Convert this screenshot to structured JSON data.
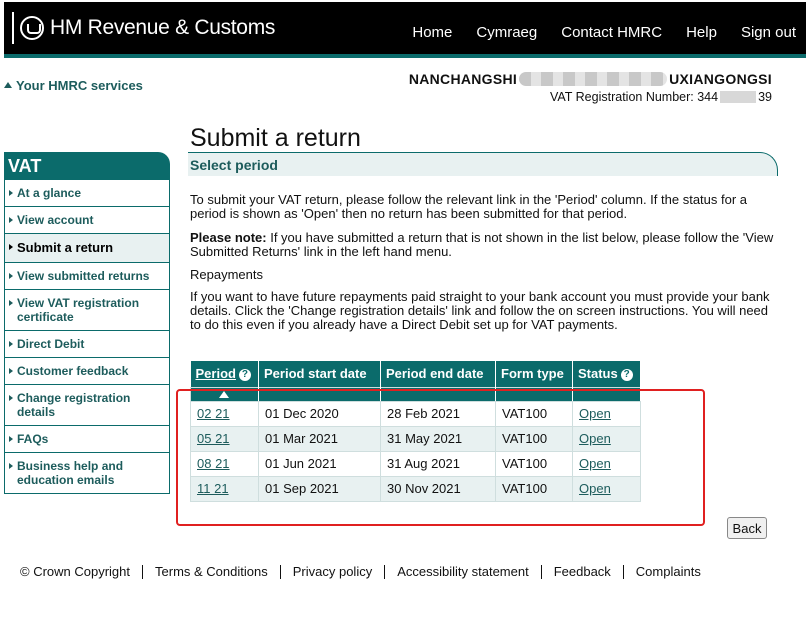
{
  "header": {
    "brand": "HM Revenue & Customs",
    "nav": [
      "Home",
      "Cymraeg",
      "Contact HMRC",
      "Help",
      "Sign out"
    ]
  },
  "services_link": "Your HMRC services",
  "company": {
    "name_start": "NANCHANGSHI",
    "name_end": "UXIANGONGSI",
    "vat_label": "VAT Registration Number: 344",
    "vat_end": "39"
  },
  "sidebar": {
    "title": "VAT",
    "items": [
      {
        "label": "At a glance"
      },
      {
        "label": "View account"
      },
      {
        "label": "Submit a return"
      },
      {
        "label": "View submitted returns"
      },
      {
        "label": "View VAT registration certificate"
      },
      {
        "label": "Direct Debit"
      },
      {
        "label": "Customer feedback"
      },
      {
        "label": "Change registration details"
      },
      {
        "label": "FAQs"
      },
      {
        "label": "Business help and education emails"
      }
    ]
  },
  "main": {
    "title": "Submit a return",
    "subtitle": "Select period",
    "intro": "To submit your VAT return, please follow the relevant link in the 'Period' column. If the status for a period is shown as 'Open' then no return has been submitted for that period.",
    "note_label": "Please note:",
    "note_text": " If you have submitted a return that is not shown in the list below, please follow the 'View Submitted Returns' link in the left hand menu.",
    "repayments_heading": "Repayments",
    "repayments_text": "If you want to have future repayments paid straight to your bank account you must provide your bank details. Click the 'Change registration details' link and follow the on screen instructions. You will need to do this even if you already have a Direct Debit set up for VAT payments."
  },
  "table": {
    "headers": [
      "Period",
      "Period start date",
      "Period end date",
      "Form type",
      "Status"
    ],
    "rows": [
      {
        "period": "02 21",
        "start": "01 Dec 2020",
        "end": "28 Feb 2021",
        "form": "VAT100",
        "status": "Open"
      },
      {
        "period": "05 21",
        "start": "01 Mar 2021",
        "end": "31 May 2021",
        "form": "VAT100",
        "status": "Open"
      },
      {
        "period": "08 21",
        "start": "01 Jun 2021",
        "end": "31 Aug 2021",
        "form": "VAT100",
        "status": "Open"
      },
      {
        "period": "11 21",
        "start": "01 Sep 2021",
        "end": "30 Nov 2021",
        "form": "VAT100",
        "status": "Open"
      }
    ]
  },
  "back_label": "Back",
  "footer": [
    "© Crown Copyright",
    "Terms & Conditions",
    "Privacy policy",
    "Accessibility statement",
    "Feedback",
    "Complaints"
  ],
  "colors": {
    "brand": "#0b6b6b",
    "highlight": "#e02020"
  }
}
